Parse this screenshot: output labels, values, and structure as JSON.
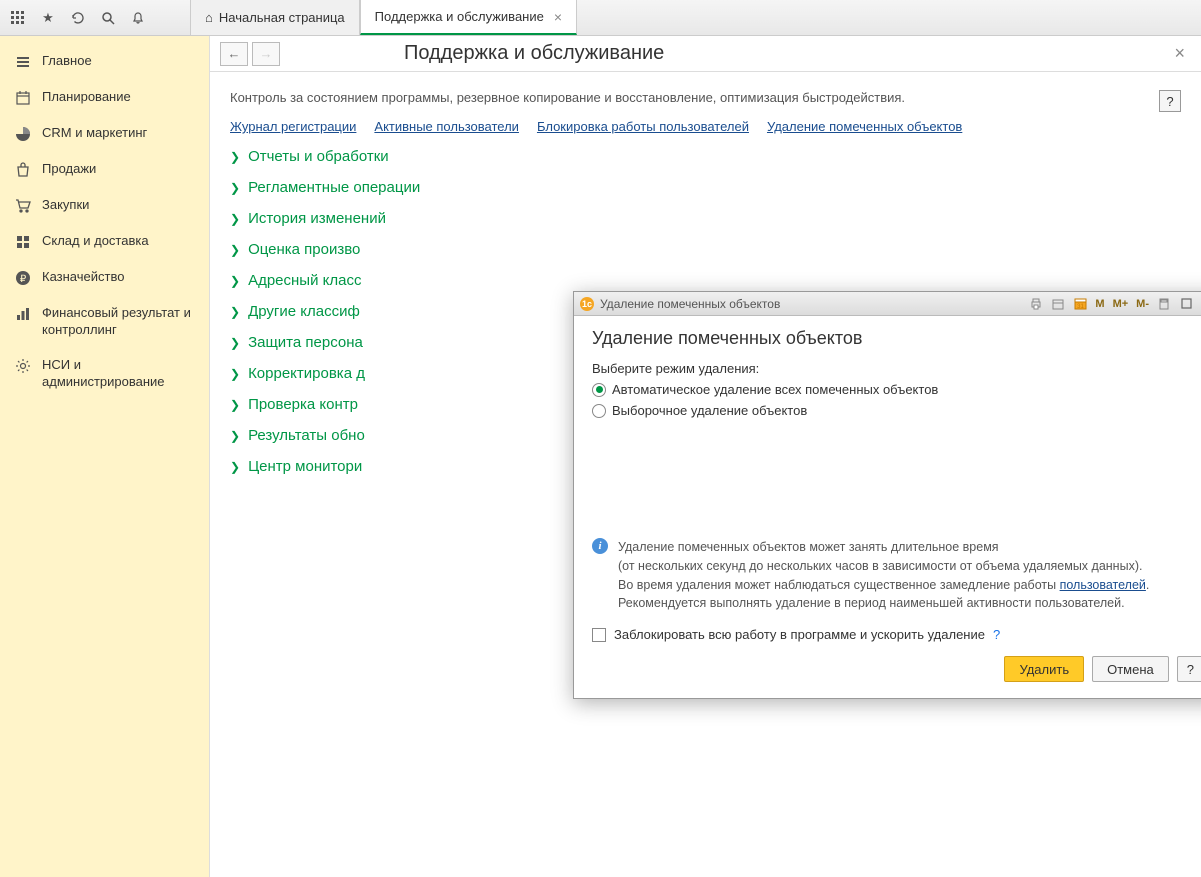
{
  "tabs": {
    "home": "Начальная страница",
    "active": "Поддержка и обслуживание"
  },
  "sidebar": [
    {
      "icon": "menu",
      "label": "Главное"
    },
    {
      "icon": "plan",
      "label": "Планирование"
    },
    {
      "icon": "pie",
      "label": "CRM и маркетинг"
    },
    {
      "icon": "bag",
      "label": "Продажи"
    },
    {
      "icon": "cart",
      "label": "Закупки"
    },
    {
      "icon": "boxes",
      "label": "Склад и доставка"
    },
    {
      "icon": "ruble",
      "label": "Казначейство"
    },
    {
      "icon": "chart",
      "label": "Финансовый результат и контроллинг"
    },
    {
      "icon": "gear",
      "label": "НСИ и администрирование"
    }
  ],
  "page": {
    "title": "Поддержка и обслуживание",
    "desc": "Контроль за состоянием программы, резервное копирование и восстановление, оптимизация быстродействия.",
    "help": "?",
    "links": [
      "Журнал регистрации",
      "Активные пользователи",
      "Блокировка работы пользователей",
      "Удаление помеченных объектов"
    ],
    "tree": [
      "Отчеты и обработки",
      "Регламентные операции",
      "История изменений",
      "Оценка произво",
      "Адресный класс",
      "Другие классиф",
      "Защита персона",
      "Корректировка д",
      "Проверка контр",
      "Результаты обно",
      "Центр монитори"
    ]
  },
  "modal": {
    "window_title": "Удаление помеченных объектов",
    "heading": "Удаление помеченных объектов",
    "mode_label": "Выберите режим удаления:",
    "radio1": "Автоматическое удаление всех помеченных объектов",
    "radio2": "Выборочное удаление объектов",
    "info_line1": "Удаление помеченных объектов может занять длительное время",
    "info_line2": "(от нескольких секунд до нескольких часов в зависимости от объема удаляемых данных).",
    "info_line3a": "Во время удаления может наблюдаться существенное замедление работы ",
    "info_link": "пользователей",
    "info_line3b": ".",
    "info_line4": "Рекомендуется выполнять удаление в период наименьшей активности пользователей.",
    "check_label": "Заблокировать всю работу в программе и ускорить удаление",
    "q": "?",
    "btn_delete": "Удалить",
    "btn_cancel": "Отмена",
    "btn_help": "?",
    "win_m": "M",
    "win_mp": "M+",
    "win_mm": "M-"
  }
}
